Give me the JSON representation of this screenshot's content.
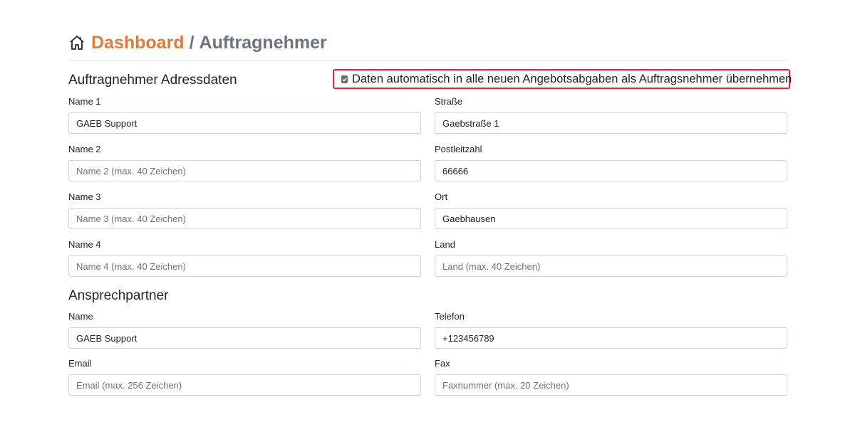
{
  "breadcrumb": {
    "home_icon": "home-icon",
    "link_label": "Dashboard",
    "separator": "/",
    "current": "Auftragnehmer"
  },
  "address_section": {
    "title": "Auftragnehmer Adressdaten",
    "auto_apply": {
      "checked": true,
      "label": "Daten automatisch in alle neuen Angebotsabgaben als Auftragsnehmer übernehmen"
    },
    "fields": {
      "name1": {
        "label": "Name 1",
        "value": "GAEB Support",
        "placeholder": "Name 1 (max. 40 Zeichen)"
      },
      "name2": {
        "label": "Name 2",
        "value": "",
        "placeholder": "Name 2 (max. 40 Zeichen)"
      },
      "name3": {
        "label": "Name 3",
        "value": "",
        "placeholder": "Name 3 (max. 40 Zeichen)"
      },
      "name4": {
        "label": "Name 4",
        "value": "",
        "placeholder": "Name 4 (max. 40 Zeichen)"
      },
      "street": {
        "label": "Straße",
        "value": "Gaebstraße 1",
        "placeholder": ""
      },
      "zip": {
        "label": "Postleitzahl",
        "value": "66666",
        "placeholder": ""
      },
      "city": {
        "label": "Ort",
        "value": "Gaebhausen",
        "placeholder": ""
      },
      "country": {
        "label": "Land",
        "value": "",
        "placeholder": "Land (max. 40 Zeichen)"
      }
    }
  },
  "contact_section": {
    "title": "Ansprechpartner",
    "fields": {
      "name": {
        "label": "Name",
        "value": "GAEB Support",
        "placeholder": ""
      },
      "phone": {
        "label": "Telefon",
        "value": "+123456789",
        "placeholder": ""
      },
      "email": {
        "label": "Email",
        "value": "",
        "placeholder": "Email (max. 256 Zeichen)"
      },
      "fax": {
        "label": "Fax",
        "value": "",
        "placeholder": "Faxnummer (max. 20 Zeichen)"
      }
    }
  },
  "colors": {
    "accent": "#e07b39",
    "muted": "#6c757d",
    "highlight_border": "#d9293a"
  }
}
